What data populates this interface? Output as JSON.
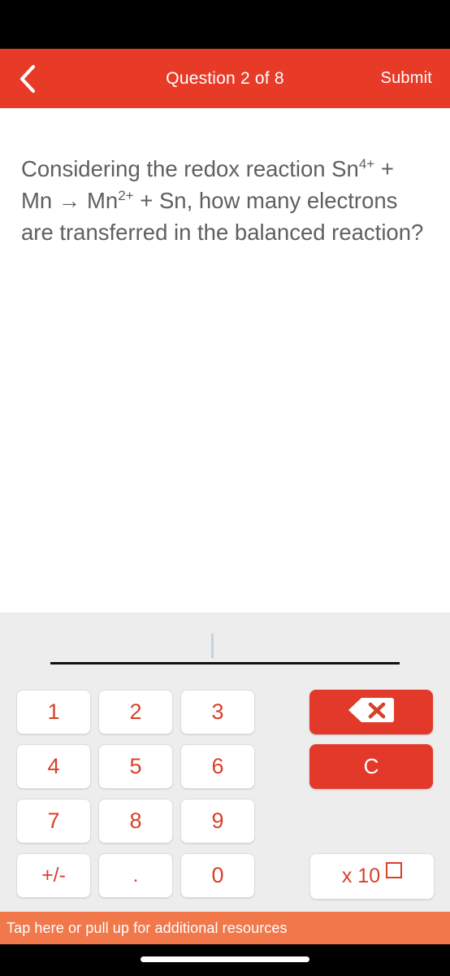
{
  "header": {
    "back_icon": "chevron-left-icon",
    "title": "Question 2 of 8",
    "submit_label": "Submit",
    "background_color": "#E73B28",
    "text_color": "#FFFFFF"
  },
  "question": {
    "text_part1": "Considering the redox reaction Sn",
    "sup1": "4+",
    "text_part2": " + Mn → Mn",
    "sup2": "2+",
    "text_part3": " + Sn, how many electrons are transferred in the balanced reaction?",
    "text_color": "#5F5F5F"
  },
  "answer": {
    "value": "",
    "caret_visible": true,
    "caret_color": "#C3D2DE",
    "rule_color": "#111111"
  },
  "keypad": {
    "background_color": "#EDEDED",
    "key_text_color": "#D9402A",
    "keys": [
      {
        "label": "1",
        "name": "key-1"
      },
      {
        "label": "2",
        "name": "key-2"
      },
      {
        "label": "3",
        "name": "key-3"
      },
      {
        "label": "4",
        "name": "key-4"
      },
      {
        "label": "5",
        "name": "key-5"
      },
      {
        "label": "6",
        "name": "key-6"
      },
      {
        "label": "7",
        "name": "key-7"
      },
      {
        "label": "8",
        "name": "key-8"
      },
      {
        "label": "9",
        "name": "key-9"
      },
      {
        "label": "+/-",
        "name": "key-sign"
      },
      {
        "label": ".",
        "name": "key-decimal"
      },
      {
        "label": "0",
        "name": "key-0"
      }
    ],
    "side": {
      "backspace_icon": "backspace-delete-icon",
      "clear_label": "C",
      "exponent_label": "x 10",
      "exponent_placeholder": "□",
      "red_color": "#E3392A"
    }
  },
  "footer": {
    "banner_text": "Tap here or pull up for additional resources",
    "background_color": "#F0784B",
    "text_color": "#FFFFFF"
  }
}
